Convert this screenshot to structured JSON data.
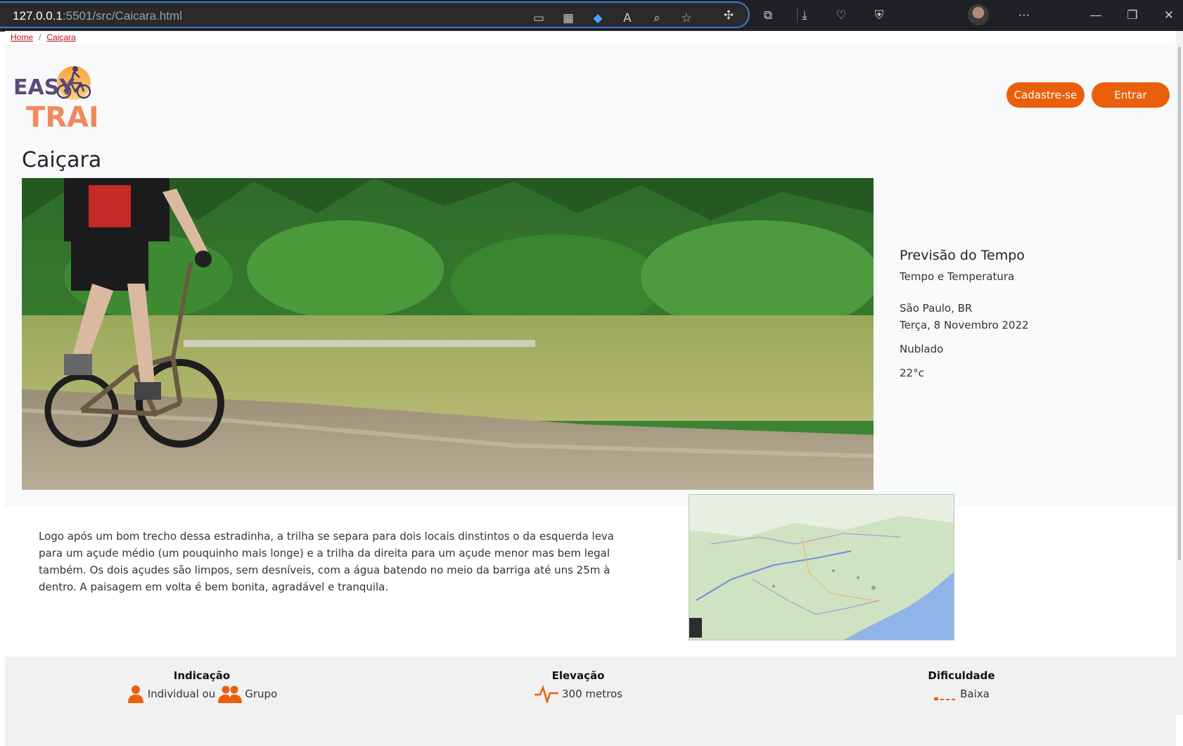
{
  "browser": {
    "url_host": "127.0.0.1",
    "url_path": ":5501/src/Caicara.html"
  },
  "breadcrumb": {
    "home": "Home",
    "separator": "/",
    "current": "Caiçara"
  },
  "logo": {
    "line1": "EASY",
    "line2": "TRAIL"
  },
  "header": {
    "signup_label": "Cadastre-se",
    "login_label": "Entrar"
  },
  "page": {
    "title": "Caiçara"
  },
  "weather": {
    "title": "Previsão do Tempo",
    "subtitle": "Tempo e Temperatura",
    "location": "São Paulo, BR",
    "date": "Terça, 8 Novembro 2022",
    "condition": "Nublado",
    "temperature": "22°c"
  },
  "description": "Logo após um bom trecho dessa estradinha, a trilha se separa para dois locais dinstintos o da esquerda leva para um açude médio (um pouquinho mais longe) e a trilha da direita para um açude menor mas bem legal também. Os dois açudes são limpos, sem desníveis, com a água batendo no meio da barriga até uns 25m à dentro. A paisagem em volta é bem bonita, agradável e tranquila.",
  "stats": {
    "indicacao": {
      "title": "Indicação",
      "individual": "Individual ou",
      "group": "Grupo"
    },
    "elevacao": {
      "title": "Elevação",
      "value": "300 metros"
    },
    "dificuldade": {
      "title": "Dificuldade",
      "value": "Baixa"
    }
  },
  "colors": {
    "accent": "#ea5f0b",
    "breadcrumb_link": "#c0101a"
  }
}
